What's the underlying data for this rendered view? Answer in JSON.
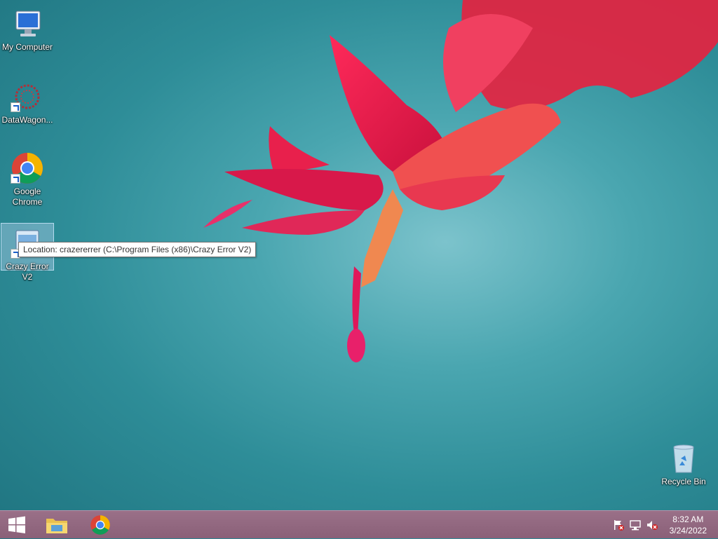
{
  "desktop": {
    "icons": [
      {
        "label": "My Computer",
        "icon": "computer-icon"
      },
      {
        "label": "DataWagon...",
        "icon": "datawagon-icon"
      },
      {
        "label": "Google Chrome",
        "icon": "chrome-icon"
      },
      {
        "label": "Crazy Error V2",
        "icon": "crazy-error-icon"
      },
      {
        "label": "Recycle Bin",
        "icon": "recycle-bin-icon"
      }
    ],
    "tooltip": "Location: crazererrer (C:\\Program Files (x86)\\Crazy Error V2)"
  },
  "taskbar": {
    "start": "start-icon",
    "pinned": [
      "file-explorer-icon",
      "chrome-icon"
    ],
    "tray": [
      "action-center-flag-icon",
      "network-icon",
      "volume-muted-icon"
    ],
    "time": "8:32 AM",
    "date": "3/24/2022"
  },
  "colors": {
    "accent": "#8a6078",
    "selection": "#aacde6"
  }
}
